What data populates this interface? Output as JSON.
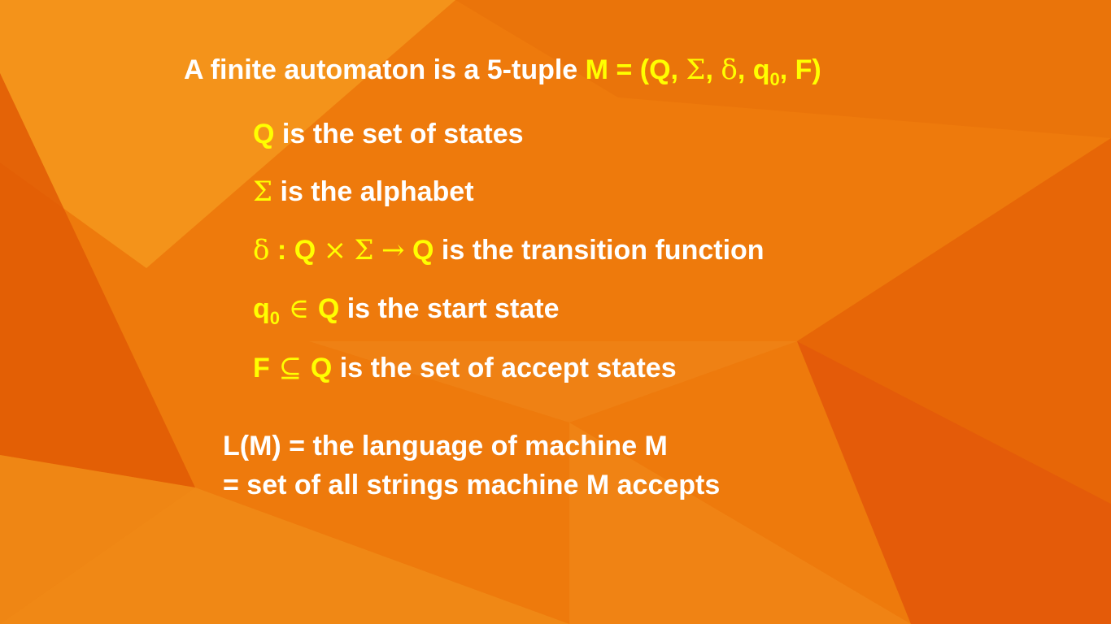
{
  "slide": {
    "background": {
      "primary_color": "#ee7a0c",
      "light_color": "#f59a1e",
      "dark_color": "#e05a05",
      "text_color": "#ffffff",
      "highlight_color": "#ffff00"
    },
    "title": {
      "prefix": "A finite automaton is a 5-tuple ",
      "tuple": {
        "m_eq": "M = (Q, ",
        "sigma": "Σ",
        "sep1": ", ",
        "delta": "δ",
        "sep2": ", q",
        "q_sub": "0",
        "end": ", F)"
      }
    },
    "definitions": {
      "states": {
        "symbol": "Q",
        "text": " is the set of states"
      },
      "alphabet": {
        "symbol": "Σ",
        "text": " is the alphabet"
      },
      "transition": {
        "delta": "δ",
        "colon_q": " : Q ",
        "times": "×",
        "space1": " ",
        "sigma": "Σ",
        "space2": " ",
        "arrow": "→",
        "q": " Q",
        "text": "  is the transition function"
      },
      "start": {
        "q": "q",
        "q_sub": "0",
        "in": " ∈ ",
        "Q": "Q",
        "text": " is the start state"
      },
      "accept": {
        "F": "F",
        "subseteq": " ⊆ ",
        "Q": "Q",
        "text": " is the set of accept states"
      }
    },
    "language": {
      "line1": "L(M)  = the language of machine M",
      "line2": "= set of all strings machine M accepts"
    }
  }
}
